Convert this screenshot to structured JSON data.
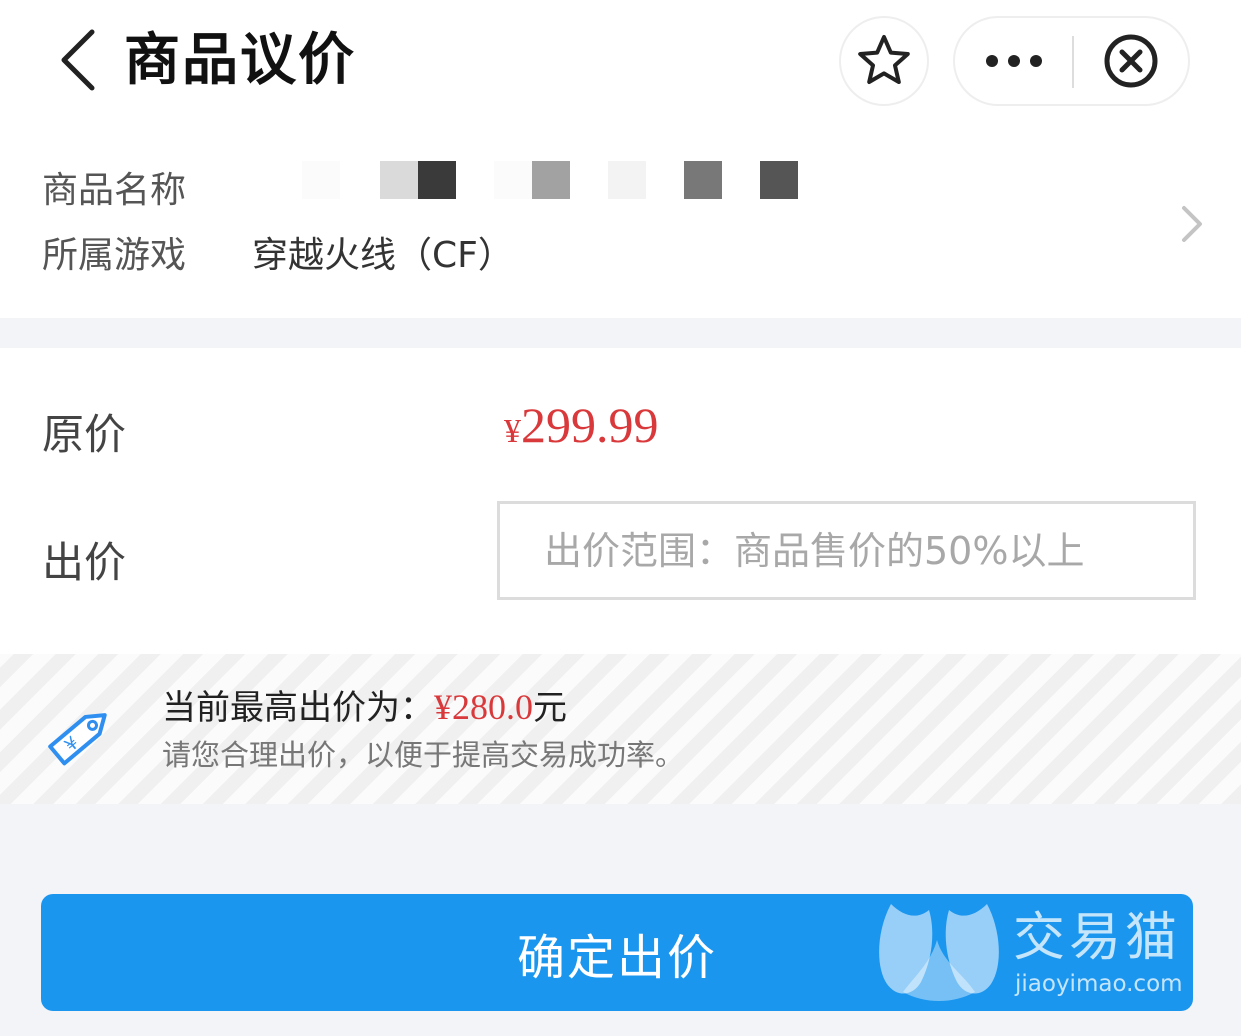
{
  "header": {
    "title": "商品议价",
    "icons": {
      "back": "chevron-left-icon",
      "favorite": "star-icon",
      "more": "more-dots-icon",
      "close": "close-circle-icon"
    }
  },
  "product": {
    "name_label": "商品名称",
    "game_label": "所属游戏",
    "game_value": "穿越火线（CF）"
  },
  "pricing": {
    "original_label": "原价",
    "original_currency": "¥",
    "original_amount": "299.99",
    "bid_label": "出价",
    "bid_placeholder": "出价范围：商品售价的50%以上",
    "bid_value": ""
  },
  "notice": {
    "highest_prefix": "当前最高出价为：",
    "highest_amount": "¥280.0",
    "highest_suffix": "元",
    "hint": "请您合理出价，以便于提高交易成功率。"
  },
  "confirm": {
    "label": "确定出价",
    "watermark_brand": "交易猫",
    "watermark_domain": "jiaoyimao.com"
  },
  "colors": {
    "accent_blue": "#1b96ef",
    "price_red": "#d9393b",
    "tag_icon_blue": "#2f8ff0"
  }
}
